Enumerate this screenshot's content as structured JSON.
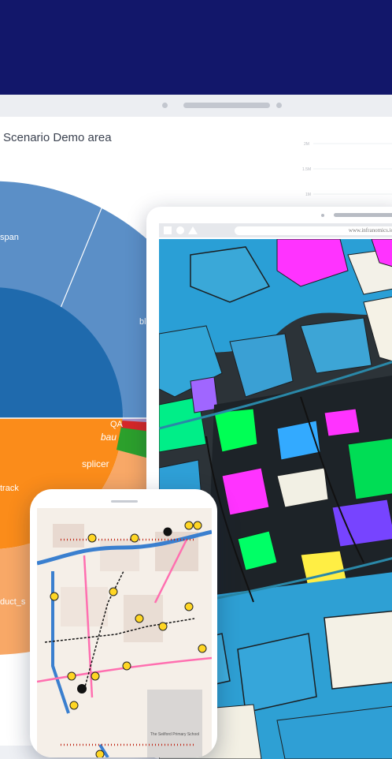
{
  "dashboard": {
    "chart_title": "Scenario Demo area"
  },
  "chart_data": {
    "type": "sunburst",
    "title": "Scenario Demo area",
    "visible_segment_labels": [
      "span",
      "bl",
      "QA",
      "bau",
      "splicer",
      "track",
      "duct_s"
    ],
    "mini_chart_y_ticks": [
      "2M",
      "1.5M",
      "1M"
    ],
    "colors": {
      "outer_blue": "#5b8fc7",
      "inner_blue": "#1f6aad",
      "orange": "#fb8c1a",
      "light_orange": "#f8a867",
      "green": "#2ca02c",
      "light_green": "#78c26b",
      "red": "#d62728",
      "light_red": "#e06a6a",
      "purple": "#a993c6"
    }
  },
  "tablet": {
    "url": "www.infranomics.io"
  },
  "phone": {
    "map_label": "The Seilford Primary School"
  }
}
